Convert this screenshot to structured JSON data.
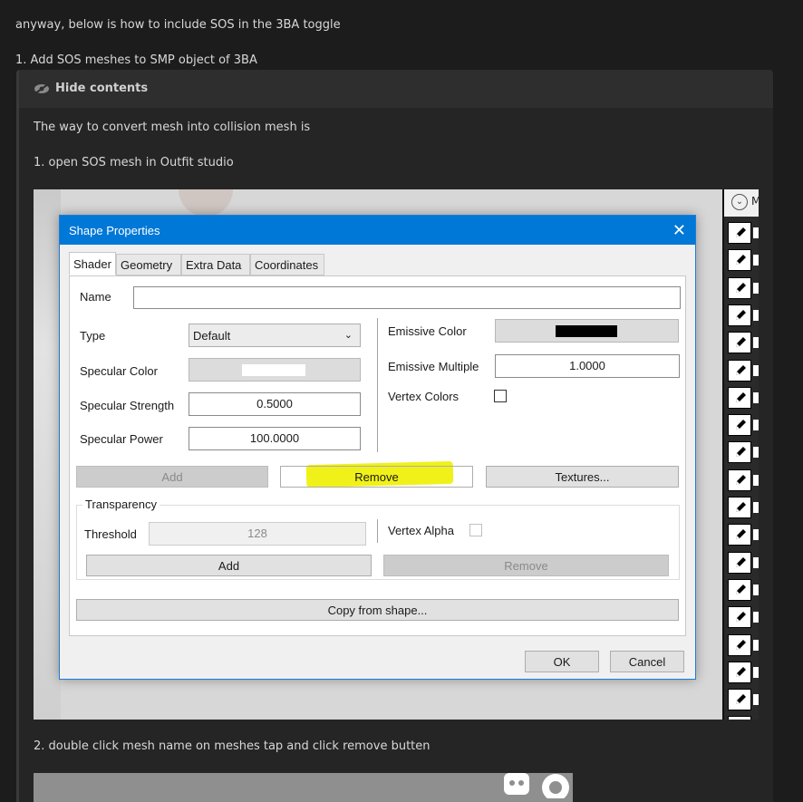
{
  "post": {
    "intro": "anyway, below is how to include SOS in the 3BA toggle",
    "step1": "1. Add SOS meshes to SMP object of 3BA"
  },
  "spoiler": {
    "toggle_label": "Hide contents",
    "line1": "The way to convert mesh into collision mesh is",
    "line2": "1. open SOS mesh in Outfit studio",
    "line3": "2. double click mesh name on meshes tap and click remove butten"
  },
  "side_panel": {
    "header_letter": "M"
  },
  "dialog": {
    "title": "Shape Properties",
    "tabs": [
      "Shader",
      "Geometry",
      "Extra Data",
      "Coordinates"
    ],
    "name_label": "Name",
    "name_value": "",
    "type_label": "Type",
    "type_value": "Default",
    "specular_color_label": "Specular Color",
    "specular_strength_label": "Specular Strength",
    "specular_strength_value": "0.5000",
    "specular_power_label": "Specular Power",
    "specular_power_value": "100.0000",
    "emissive_color_label": "Emissive Color",
    "emissive_multiple_label": "Emissive Multiple",
    "emissive_multiple_value": "1.0000",
    "vertex_colors_label": "Vertex Colors",
    "add_label": "Add",
    "remove_label": "Remove",
    "textures_label": "Textures...",
    "transparency_label": "Transparency",
    "threshold_label": "Threshold",
    "threshold_value": "128",
    "vertex_alpha_label": "Vertex Alpha",
    "trans_add_label": "Add",
    "trans_remove_label": "Remove",
    "copy_label": "Copy from shape...",
    "ok_label": "OK",
    "cancel_label": "Cancel"
  },
  "colors": {
    "titlebar": "#0078d7",
    "highlight": "#eef000",
    "emissive_swatch": "#000000",
    "specular_swatch": "#ffffff"
  }
}
